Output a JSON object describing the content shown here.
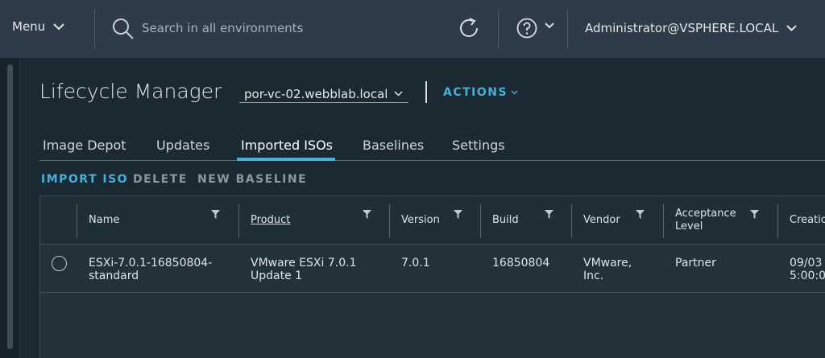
{
  "header": {
    "menu_label": "Menu",
    "search_placeholder": "Search in all environments",
    "user_label": "Administrator@VSPHERE.LOCAL"
  },
  "page": {
    "title": "Lifecycle Manager",
    "vcenter_selected": "por-vc-02.webblab.local",
    "actions_label": "ACTIONS"
  },
  "tabs": [
    {
      "label": "Image Depot",
      "active": false
    },
    {
      "label": "Updates",
      "active": false
    },
    {
      "label": "Imported ISOs",
      "active": true
    },
    {
      "label": "Baselines",
      "active": false
    },
    {
      "label": "Settings",
      "active": false
    }
  ],
  "toolbar": {
    "import_iso": "IMPORT ISO",
    "delete": "DELETE",
    "new_baseline": "NEW BASELINE"
  },
  "table": {
    "columns": {
      "name": "Name",
      "product": "Product",
      "version": "Version",
      "build": "Build",
      "vendor": "Vendor",
      "acceptance_l1": "Acceptance",
      "acceptance_l2": "Level",
      "creation": "Creatio"
    },
    "rows": [
      {
        "name_l1": "ESXi-7.0.1-16850804-",
        "name_l2": "standard",
        "product_l1": "VMware ESXi 7.0.1",
        "product_l2": "Update 1",
        "version": "7.0.1",
        "build": "16850804",
        "vendor_l1": "VMware,",
        "vendor_l2": "Inc.",
        "acceptance": "Partner",
        "creation_l1": "09/03",
        "creation_l2": "5:00:0"
      }
    ]
  },
  "colors": {
    "accent": "#49afd9",
    "header_bg": "#2d3c48",
    "page_bg": "#1b2a32",
    "disabled_text": "#8c979e"
  }
}
